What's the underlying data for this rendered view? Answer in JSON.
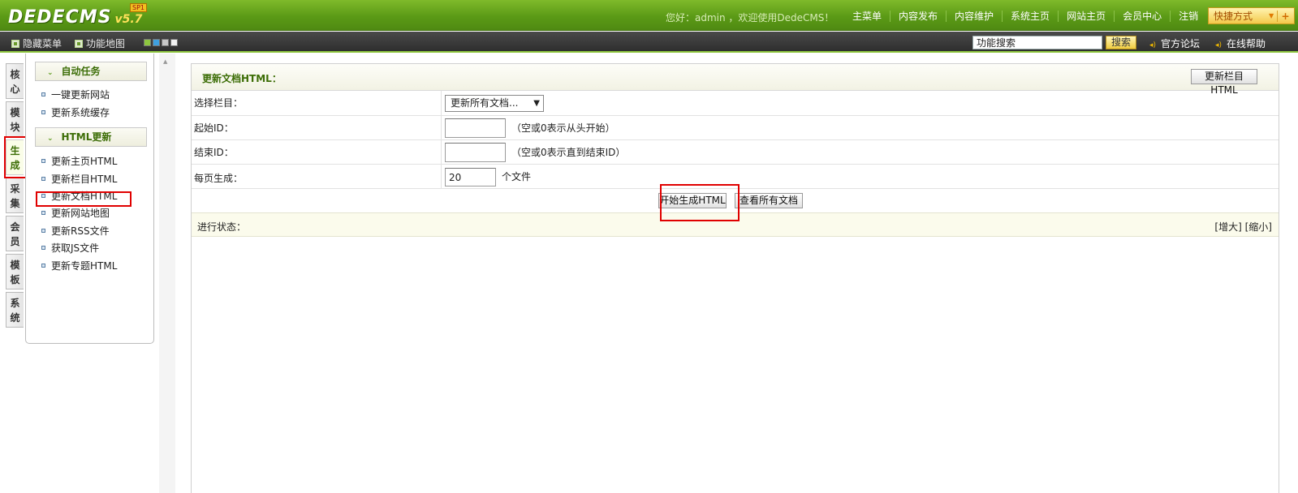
{
  "header": {
    "logo_text": "DEDECMS",
    "logo_version": "v5.7",
    "logo_badge": "SP1",
    "welcome": "您好：admin ，欢迎使用DedeCMS！",
    "nav": [
      "主菜单",
      "内容发布",
      "内容维护",
      "系统主页",
      "网站主页",
      "会员中心",
      "注销"
    ],
    "quick_menu": "快捷方式",
    "quick_plus": "+"
  },
  "toolbar": {
    "hide_menu": "隐藏菜单",
    "function_map": "功能地图",
    "swatch_colors": [
      "#8dc63f",
      "#3fa0e0",
      "#c8c8c8",
      "#f2f2f2"
    ],
    "search_value": "功能搜索",
    "search_button": "搜索",
    "forum": "官方论坛",
    "help": "在线帮助"
  },
  "vtabs": [
    "核心",
    "模块",
    "生成",
    "采集",
    "会员",
    "模板",
    "系统"
  ],
  "active_vtab": "生成",
  "menu": {
    "group1_title": "自动任务",
    "group1_items": [
      "一键更新网站",
      "更新系统缓存"
    ],
    "group2_title": "HTML更新",
    "group2_items": [
      "更新主页HTML",
      "更新栏目HTML",
      "更新文档HTML",
      "更新网站地图",
      "更新RSS文件",
      "获取JS文件",
      "更新专题HTML"
    ]
  },
  "main": {
    "title": "更新文档HTML：",
    "update_category_button": "更新栏目HTML",
    "select_label": "选择栏目：",
    "select_value": "更新所有文档...",
    "start_id_label": "起始ID：",
    "start_id_value": "",
    "start_id_hint": "（空或0表示从头开始）",
    "end_id_label": "结束ID：",
    "end_id_value": "",
    "end_id_hint": "（空或0表示直到结束ID）",
    "per_page_label": "每页生成：",
    "per_page_value": "20",
    "per_page_unit": "个文件",
    "start_button": "开始生成HTML",
    "view_all_button": "查看所有文档",
    "status_label": "进行状态：",
    "enlarge": "[增大]",
    "shrink": "[缩小]"
  }
}
